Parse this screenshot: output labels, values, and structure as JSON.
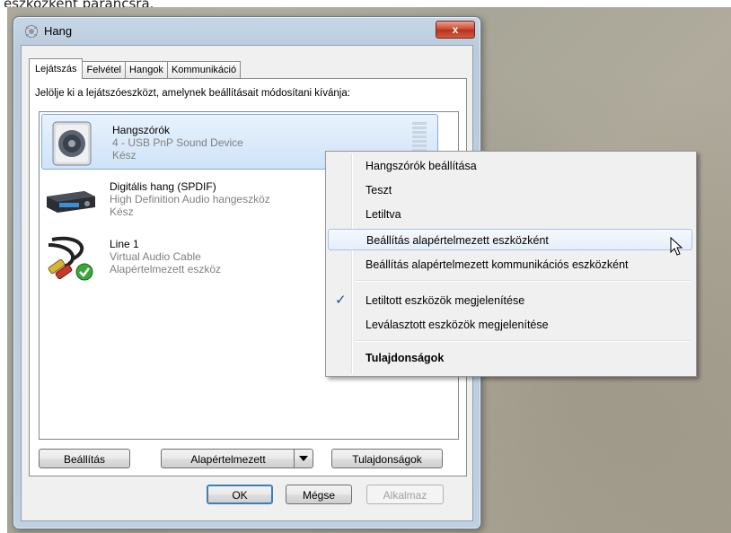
{
  "top_fragment": "eszközként parancsra.",
  "window": {
    "title": "Hang",
    "close_symbol": "x"
  },
  "tabs": [
    {
      "label": "Lejátszás",
      "active": true
    },
    {
      "label": "Felvétel",
      "active": false
    },
    {
      "label": "Hangok",
      "active": false
    },
    {
      "label": "Kommunikáció",
      "active": false
    }
  ],
  "instruction": "Jelölje ki a lejátszóeszközt, amelynek beállításait módosítani kívánja:",
  "devices": [
    {
      "name": "Hangszórók",
      "line1": "4 - USB PnP Sound Device",
      "line2": "Kész",
      "icon": "speaker-icon",
      "selected": true
    },
    {
      "name": "Digitális hang (SPDIF)",
      "line1": "High Definition Audio hangeszköz",
      "line2": "Kész",
      "icon": "spdif-device-icon",
      "selected": false
    },
    {
      "name": "Line 1",
      "line1": "Virtual Audio Cable",
      "line2": "Alapértelmezett eszköz",
      "icon": "rca-cable-icon",
      "selected": false
    }
  ],
  "buttons": {
    "configure": "Beállítás",
    "set_default": "Alapértelmezett",
    "properties": "Tulajdonságok",
    "ok": "OK",
    "cancel": "Mégse",
    "apply": "Alkalmaz"
  },
  "context_menu": {
    "items": [
      {
        "label": "Hangszórók beállítása"
      },
      {
        "label": "Teszt"
      },
      {
        "label": "Letiltva"
      },
      {
        "label": "Beállítás alapértelmezett eszközként",
        "hover": true
      },
      {
        "label": "Beállítás alapértelmezett kommunikációs eszközként"
      },
      {
        "label": "Letiltott eszközök megjelenítése",
        "checked": true
      },
      {
        "label": "Leválasztott eszközök megjelenítése"
      },
      {
        "label": "Tulajdonságok",
        "bold": true
      }
    ],
    "check_symbol": "✓"
  },
  "colors": {
    "accent": "#3c7fb1",
    "selection": "#cfe3f8",
    "check": "#1c4f9c"
  }
}
